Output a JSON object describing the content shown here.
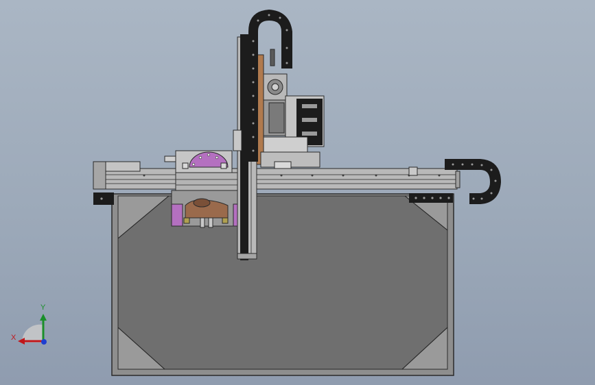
{
  "viewport": {
    "background_top": "#aab6c4",
    "background_bottom": "#8f9caf"
  },
  "model": {
    "colors": {
      "frame": "#8e8e8e",
      "frame_edge": "#2a2a2a",
      "panel_fill": "#6f6f6f",
      "rail": "#b9b9b9",
      "cable_chain": "#1c1c1c",
      "cable_dot": "#9a9a9a",
      "copper_plate": "#b07a4e",
      "purple_part": "#b470c0",
      "brown_part": "#9a6a4c",
      "silver_part": "#d2d2d2"
    }
  },
  "triad": {
    "x_label": "X",
    "y_label": "Y",
    "x_color": "#c0161a",
    "y_color": "#1a8f2a",
    "z_color": "#1f3fd0",
    "icons": [
      "x-axis-arrow-icon",
      "y-axis-arrow-icon",
      "z-axis-origin-icon"
    ]
  }
}
